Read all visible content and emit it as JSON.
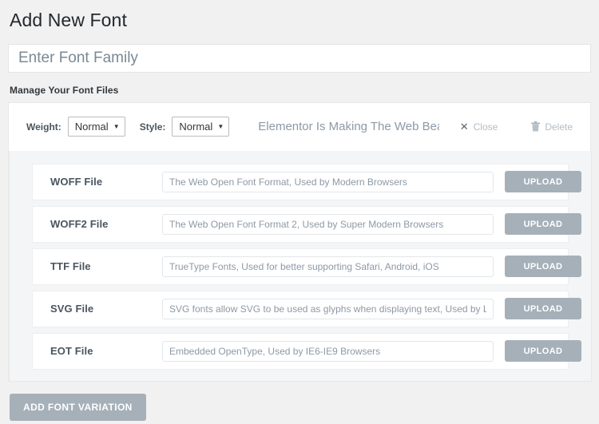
{
  "page": {
    "title": "Add New Font"
  },
  "font_family": {
    "placeholder": "Enter Font Family",
    "value": ""
  },
  "section": {
    "label": "Manage Your Font Files"
  },
  "variation": {
    "weight": {
      "label": "Weight:",
      "value": "Normal",
      "caret": "▼"
    },
    "style": {
      "label": "Style:",
      "value": "Normal",
      "caret": "▼"
    },
    "preview_text": "Elementor Is Making The Web Beautiful!!!",
    "close": {
      "label": "Close",
      "icon": "close-x-icon",
      "glyph": "✕"
    },
    "delete": {
      "label": "Delete",
      "icon": "trash-icon"
    }
  },
  "files": [
    {
      "label": "WOFF File",
      "placeholder": "The Web Open Font Format, Used by Modern Browsers",
      "value": "",
      "upload_label": "UPLOAD"
    },
    {
      "label": "WOFF2 File",
      "placeholder": "The Web Open Font Format 2, Used by Super Modern Browsers",
      "value": "",
      "upload_label": "UPLOAD"
    },
    {
      "label": "TTF File",
      "placeholder": "TrueType Fonts, Used for better supporting Safari, Android, iOS",
      "value": "",
      "upload_label": "UPLOAD"
    },
    {
      "label": "SVG File",
      "placeholder": "SVG fonts allow SVG to be used as glyphs when displaying text, Used by Legacy iOS",
      "value": "",
      "upload_label": "UPLOAD"
    },
    {
      "label": "EOT File",
      "placeholder": "Embedded OpenType, Used by IE6-IE9 Browsers",
      "value": "",
      "upload_label": "UPLOAD"
    }
  ],
  "footer": {
    "add_variation_label": "ADD FONT VARIATION"
  },
  "colors": {
    "page_background": "#f1f1f1",
    "card_background": "#ffffff",
    "files_background": "#f4f5f6",
    "button_gray": "#a6b0b9",
    "muted_text": "#8d99a6",
    "heading_text": "#23282d"
  }
}
